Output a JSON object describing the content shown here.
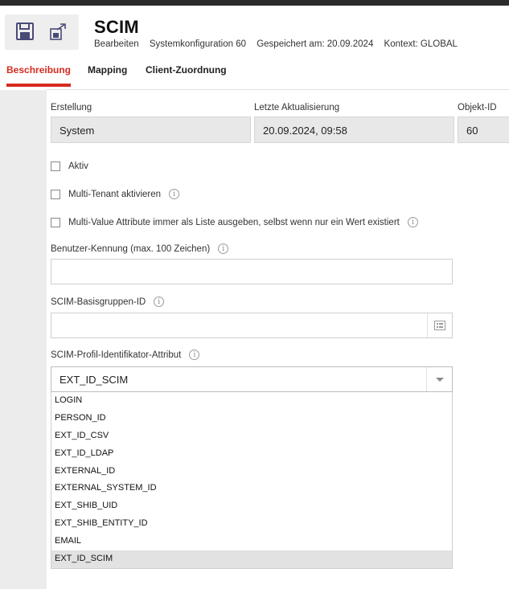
{
  "header": {
    "title": "SCIM",
    "meta": [
      "Bearbeiten",
      "Systemkonfiguration 60",
      "Gespeichert am: 20.09.2024",
      "Kontext: GLOBAL"
    ],
    "save_icon": "floppy-disk-icon",
    "export_icon": "export-icon"
  },
  "tabs": [
    {
      "label": "Beschreibung",
      "active": true
    },
    {
      "label": "Mapping",
      "active": false
    },
    {
      "label": "Client-Zuordnung",
      "active": false
    }
  ],
  "info": {
    "created_label": "Erstellung",
    "created_value": "System",
    "updated_label": "Letzte Aktualisierung",
    "updated_value": "20.09.2024, 09:58",
    "id_label": "Objekt-ID",
    "id_value": "60"
  },
  "checkboxes": [
    {
      "label": "Aktiv",
      "checked": false
    },
    {
      "label": "Multi-Tenant aktivieren",
      "checked": false
    },
    {
      "label": "Multi-Value Attribute immer als Liste ausgeben, selbst wenn nur ein Wert existiert",
      "checked": false
    }
  ],
  "fields": {
    "user_id_label": "Benutzer-Kennung (max. 100 Zeichen)",
    "user_id_value": "",
    "base_group_label": "SCIM-Basisgruppen-ID",
    "base_group_value": "",
    "profile_attr_label": "SCIM-Profil-Identifikator-Attribut",
    "profile_attr_value": "EXT_ID_SCIM"
  },
  "options": [
    "LOGIN",
    "PERSON_ID",
    "EXT_ID_CSV",
    "EXT_ID_LDAP",
    "EXTERNAL_ID",
    "EXTERNAL_SYSTEM_ID",
    "EXT_SHIB_UID",
    "EXT_SHIB_ENTITY_ID",
    "EMAIL",
    "EXT_ID_SCIM"
  ],
  "selected_option": "EXT_ID_SCIM",
  "colors": {
    "accent": "#d52b1e",
    "toolbar_icon": "#4a4a78"
  }
}
